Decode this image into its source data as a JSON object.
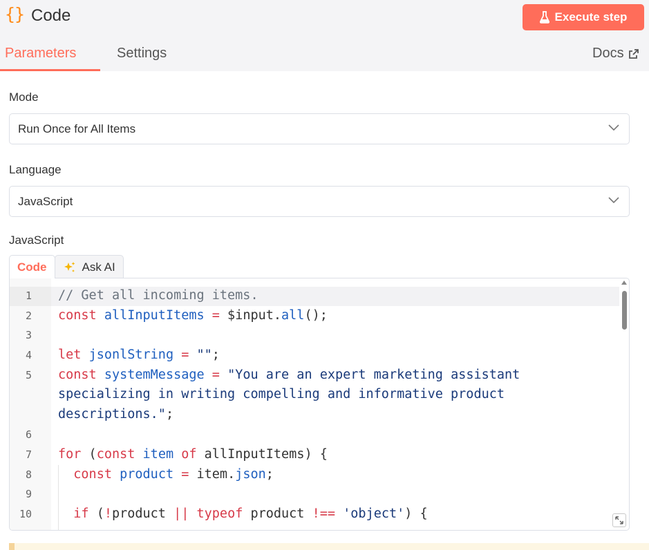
{
  "header": {
    "icon": "{}",
    "title": "Code",
    "execute_label": "Execute step"
  },
  "tabs": {
    "parameters": "Parameters",
    "settings": "Settings",
    "docs": "Docs"
  },
  "mode": {
    "label": "Mode",
    "value": "Run Once for All Items"
  },
  "language": {
    "label": "Language",
    "value": "JavaScript"
  },
  "editor": {
    "section_label": "JavaScript",
    "tab_code": "Code",
    "tab_ask_ai": "Ask AI",
    "line_numbers": [
      "1",
      "2",
      "3",
      "4",
      "5",
      "6",
      "7",
      "8",
      "9",
      "10"
    ],
    "lines": [
      "// Get all incoming items.",
      "const allInputItems = $input.all();",
      "",
      "let jsonlString = \"\";",
      "const systemMessage = \"You are an expert marketing assistant",
      "specializing in writing compelling and informative product",
      "descriptions.\";",
      "",
      "for (const item of allInputItems) {",
      "  const product = item.json;",
      "",
      "  if (!product || typeof product !== 'object') {"
    ]
  },
  "colors": {
    "accent": "#ff6d5a",
    "icon_orange": "#ff8c1a"
  }
}
